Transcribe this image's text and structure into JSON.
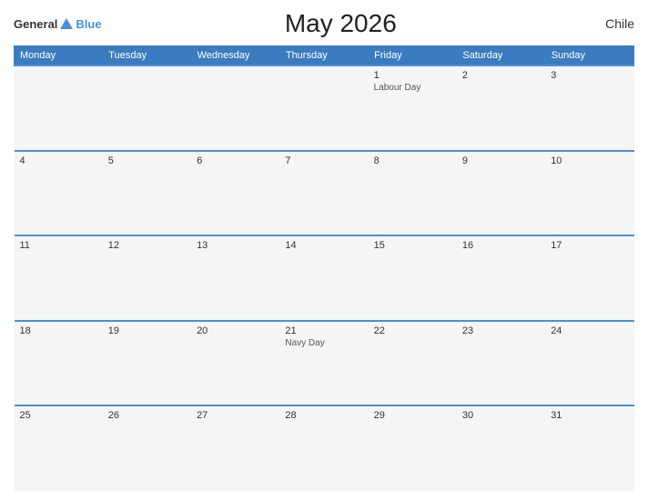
{
  "logo": {
    "general": "General",
    "blue": "Blue"
  },
  "title": "May 2026",
  "country": "Chile",
  "days_header": [
    "Monday",
    "Tuesday",
    "Wednesday",
    "Thursday",
    "Friday",
    "Saturday",
    "Sunday"
  ],
  "weeks": [
    [
      {
        "num": "",
        "holiday": ""
      },
      {
        "num": "",
        "holiday": ""
      },
      {
        "num": "",
        "holiday": ""
      },
      {
        "num": "",
        "holiday": ""
      },
      {
        "num": "1",
        "holiday": "Labour Day"
      },
      {
        "num": "2",
        "holiday": ""
      },
      {
        "num": "3",
        "holiday": ""
      }
    ],
    [
      {
        "num": "4",
        "holiday": ""
      },
      {
        "num": "5",
        "holiday": ""
      },
      {
        "num": "6",
        "holiday": ""
      },
      {
        "num": "7",
        "holiday": ""
      },
      {
        "num": "8",
        "holiday": ""
      },
      {
        "num": "9",
        "holiday": ""
      },
      {
        "num": "10",
        "holiday": ""
      }
    ],
    [
      {
        "num": "11",
        "holiday": ""
      },
      {
        "num": "12",
        "holiday": ""
      },
      {
        "num": "13",
        "holiday": ""
      },
      {
        "num": "14",
        "holiday": ""
      },
      {
        "num": "15",
        "holiday": ""
      },
      {
        "num": "16",
        "holiday": ""
      },
      {
        "num": "17",
        "holiday": ""
      }
    ],
    [
      {
        "num": "18",
        "holiday": ""
      },
      {
        "num": "19",
        "holiday": ""
      },
      {
        "num": "20",
        "holiday": ""
      },
      {
        "num": "21",
        "holiday": "Navy Day"
      },
      {
        "num": "22",
        "holiday": ""
      },
      {
        "num": "23",
        "holiday": ""
      },
      {
        "num": "24",
        "holiday": ""
      }
    ],
    [
      {
        "num": "25",
        "holiday": ""
      },
      {
        "num": "26",
        "holiday": ""
      },
      {
        "num": "27",
        "holiday": ""
      },
      {
        "num": "28",
        "holiday": ""
      },
      {
        "num": "29",
        "holiday": ""
      },
      {
        "num": "30",
        "holiday": ""
      },
      {
        "num": "31",
        "holiday": ""
      }
    ]
  ]
}
